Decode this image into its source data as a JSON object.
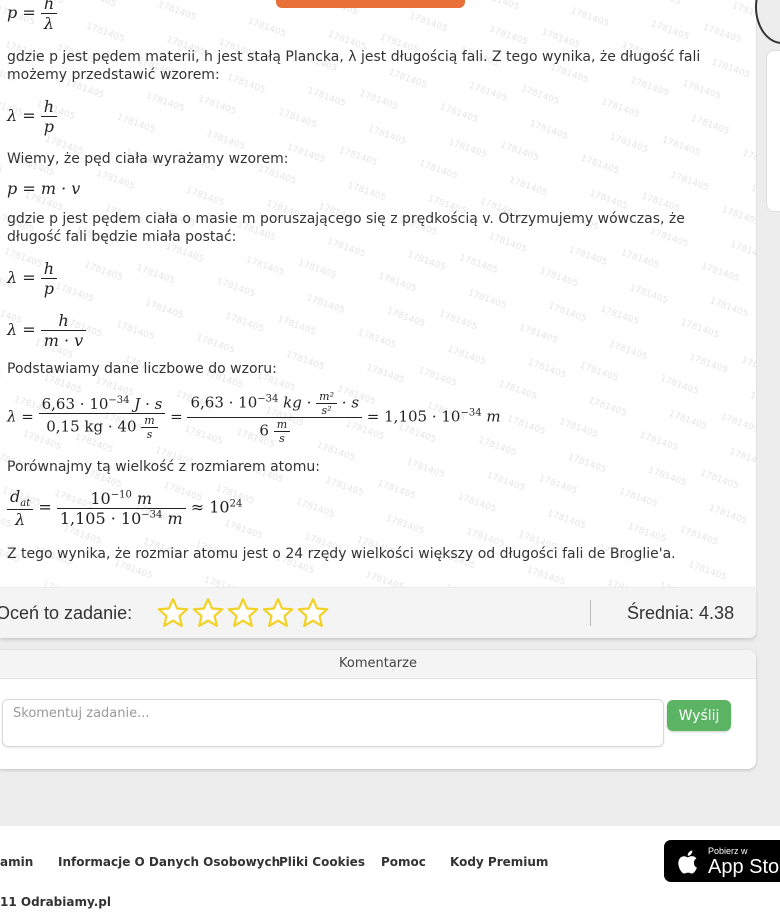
{
  "solution": {
    "watermark": "1781405",
    "eq_p_h_lambda": {
      "lhs": "p =",
      "num": "h",
      "den": "λ"
    },
    "para1": "gdzie p jest pędem materii, h jest stałą Plancka, λ jest długością fali. Z tego wynika, że długość fali możemy przedstawić wzorem:",
    "eq_lambda_h_p": {
      "lhs": "λ =",
      "num": "h",
      "den": "p"
    },
    "para2": "Wiemy, że pęd ciała wyrażamy wzorem:",
    "eq_p_mv": "p = m · v",
    "para3": "gdzie p jest pędem ciała o masie m poruszającego się z prędkością v. Otrzymujemy wówczas, że długość fali będzie miała postać:",
    "eq_lambda_h_p2": {
      "lhs": "λ =",
      "num": "h",
      "den": "p"
    },
    "eq_lambda_h_mv": {
      "lhs": "λ =",
      "num": "h",
      "den": "m · v"
    },
    "para4": "Podstawiamy dane liczbowe do wzoru:",
    "eq_numeric": {
      "lhs": "λ =",
      "f1_num": "6,63 · 10",
      "f1_num_exp": "−34",
      "f1_num_unit": " J · s",
      "f1_den": "0,15 kg · 40",
      "f1_den_unit_num": "m",
      "f1_den_unit_den": "s",
      "eq": "=",
      "f2_num": "6,63 · 10",
      "f2_num_exp": "−34",
      "f2_num_unit_pre": " kg ·",
      "f2_num_unit_num": "m²",
      "f2_num_unit_den": "s²",
      "f2_num_unit_post": "· s",
      "f2_den": "6",
      "f2_den_unit_num": "m",
      "f2_den_unit_den": "s",
      "result": "= 1,105 · 10",
      "result_exp": "−34",
      "result_unit": " m"
    },
    "para5": "Porównajmy tą wielkość z rozmiarem atomu:",
    "eq_compare": {
      "lhs_num": "d",
      "lhs_num_sub": "at",
      "lhs_den": "λ",
      "eq": "=",
      "num": "10",
      "num_exp": "−10",
      "num_unit": " m",
      "den": "1,105 · 10",
      "den_exp": "−34",
      "den_unit": " m",
      "approx": "≈ 10",
      "approx_exp": "24"
    },
    "para6": "Z tego wynika, że rozmiar atomu jest o 24 rzędy wielkości większy od długości fali de Broglie'a."
  },
  "rating": {
    "label": "Oceń to zadanie:",
    "stars": 5,
    "star_color": "#f2d22a",
    "average": "Średnia: 4.38"
  },
  "comments": {
    "title": "Komentarze",
    "placeholder": "Skomentuj zadanie...",
    "send_label": "Wyślij",
    "send_color": "#5bb463"
  },
  "footer": {
    "links": [
      "amin",
      "Informacje O Danych Osobowych",
      "Pliki Cookies",
      "Pomoc",
      "Kody Premium"
    ],
    "copyright": "11 Odrabiamy.pl",
    "appstore_small": "Pobierz w",
    "appstore_big": "App Store"
  },
  "accent": {
    "orange": "#e8713a"
  }
}
